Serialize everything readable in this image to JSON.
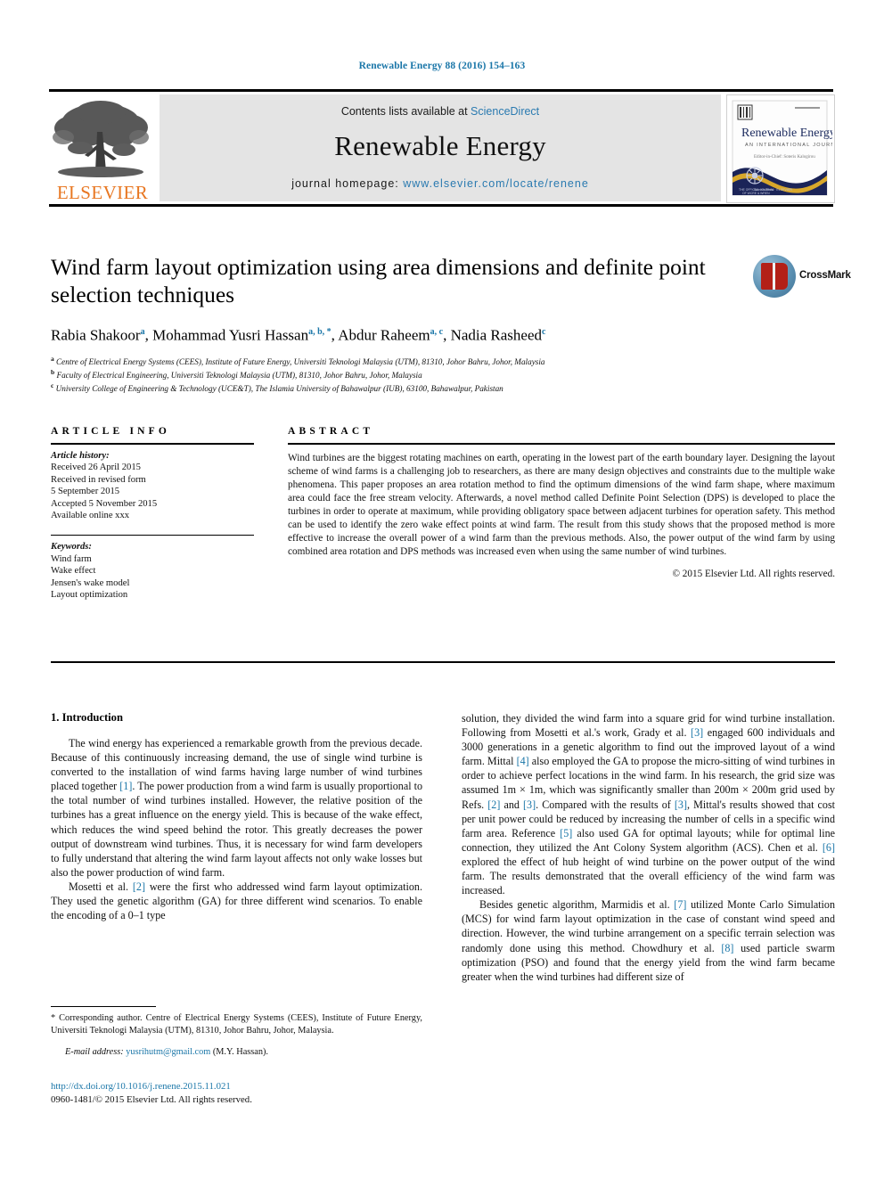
{
  "running_head": "Renewable Energy 88 (2016) 154–163",
  "masthead": {
    "contents_prefix": "Contents lists available at ",
    "sciencedirect": "ScienceDirect",
    "journal_title": "Renewable Energy",
    "homepage_label": "journal homepage: ",
    "homepage_url": "www.elsevier.com/locate/renene",
    "publisher_wordmark": "ELSEVIER",
    "cover": {
      "title": "Renewable Energy",
      "subtitle": "AN INTERNATIONAL JOURNAL",
      "editor_line": "Editor-in-Chief: Soteris Kalogirou"
    }
  },
  "article": {
    "title": "Wind farm layout optimization using area dimensions and definite point selection techniques",
    "authors": [
      {
        "name": "Rabia Shakoor",
        "marks": "a"
      },
      {
        "name": "Mohammad Yusri Hassan",
        "marks": "a, b, *"
      },
      {
        "name": "Abdur Raheem",
        "marks": "a, c"
      },
      {
        "name": "Nadia Rasheed",
        "marks": "c"
      }
    ],
    "affiliations": [
      {
        "mark": "a",
        "text": "Centre of Electrical Energy Systems (CEES), Institute of Future Energy, Universiti Teknologi Malaysia (UTM), 81310, Johor Bahru, Johor, Malaysia"
      },
      {
        "mark": "b",
        "text": "Faculty of Electrical Engineering, Universiti Teknologi Malaysia (UTM), 81310, Johor Bahru, Johor, Malaysia"
      },
      {
        "mark": "c",
        "text": "University College of Engineering & Technology (UCE&T), The Islamia University of Bahawalpur (IUB), 63100, Bahawalpur, Pakistan"
      }
    ],
    "crossmark_label": "CrossMark"
  },
  "article_info": {
    "heading": "ARTICLE INFO",
    "history_label": "Article history:",
    "history": [
      "Received 26 April 2015",
      "Received in revised form",
      "5 September 2015",
      "Accepted 5 November 2015",
      "Available online xxx"
    ],
    "keywords_label": "Keywords:",
    "keywords": [
      "Wind farm",
      "Wake effect",
      "Jensen's wake model",
      "Layout optimization"
    ]
  },
  "abstract": {
    "heading": "ABSTRACT",
    "text": "Wind turbines are the biggest rotating machines on earth, operating in the lowest part of the earth boundary layer. Designing the layout scheme of wind farms is a challenging job to researchers, as there are many design objectives and constraints due to the multiple wake phenomena. This paper proposes an area rotation method to find the optimum dimensions of the wind farm shape, where maximum area could face the free stream velocity. Afterwards, a novel method called Definite Point Selection (DPS) is developed to place the turbines in order to operate at maximum, while providing obligatory space between adjacent turbines for operation safety. This method can be used to identify the zero wake effect points at wind farm. The result from this study shows that the proposed method is more effective to increase the overall power of a wind farm than the previous methods. Also, the power output of the wind farm by using combined area rotation and DPS methods was increased even when using the same number of wind turbines.",
    "copyright": "© 2015 Elsevier Ltd. All rights reserved."
  },
  "body": {
    "section_heading": "1. Introduction",
    "left_paragraphs": [
      "The wind energy has experienced a remarkable growth from the previous decade. Because of this continuously increasing demand, the use of single wind turbine is converted to the installation of wind farms having large number of wind turbines placed together [1]. The power production from a wind farm is usually proportional to the total number of wind turbines installed. However, the relative position of the turbines has a great influence on the energy yield. This is because of the wake effect, which reduces the wind speed behind the rotor. This greatly decreases the power output of downstream wind turbines. Thus, it is necessary for wind farm developers to fully understand that altering the wind farm layout affects not only wake losses but also the power production of wind farm.",
      "Mosetti et al. [2] were the first who addressed wind farm layout optimization. They used the genetic algorithm (GA) for three different wind scenarios. To enable the encoding of a 0–1 type"
    ],
    "right_paragraphs": [
      "solution, they divided the wind farm into a square grid for wind turbine installation. Following from Mosetti et al.'s work, Grady et al. [3] engaged 600 individuals and 3000 generations in a genetic algorithm to find out the improved layout of a wind farm. Mittal [4] also employed the GA to propose the micro-sitting of wind turbines in order to achieve perfect locations in the wind farm. In his research, the grid size was assumed 1m × 1m, which was significantly smaller than 200m × 200m grid used by Refs. [2] and [3]. Compared with the results of [3], Mittal's results showed that cost per unit power could be reduced by increasing the number of cells in a specific wind farm area. Reference [5] also used GA for optimal layouts; while for optimal line connection, they utilized the Ant Colony System algorithm (ACS). Chen et al. [6] explored the effect of hub height of wind turbine on the power output of the wind farm. The results demonstrated that the overall efficiency of the wind farm was increased.",
      "Besides genetic algorithm, Marmidis et al. [7] utilized Monte Carlo Simulation (MCS) for wind farm layout optimization in the case of constant wind speed and direction. However, the wind turbine arrangement on a specific terrain selection was randomly done using this method. Chowdhury et al. [8] used particle swarm optimization (PSO) and found that the energy yield from the wind farm became greater when the wind turbines had different size of"
    ]
  },
  "footnote": {
    "corresponding": "* Corresponding author. Centre of Electrical Energy Systems (CEES), Institute of Future Energy, Universiti Teknologi Malaysia (UTM), 81310, Johor Bahru, Johor, Malaysia.",
    "email_label": "E-mail address: ",
    "email": "yusrihutm@gmail.com",
    "email_owner": " (M.Y. Hassan)."
  },
  "footer": {
    "doi": "http://dx.doi.org/10.1016/j.renene.2015.11.021",
    "issn_line": "0960-1481/© 2015 Elsevier Ltd. All rights reserved."
  },
  "colors": {
    "link": "#1a76a8",
    "elsevier_orange": "#E87722",
    "band_gray": "#e4e4e4"
  }
}
